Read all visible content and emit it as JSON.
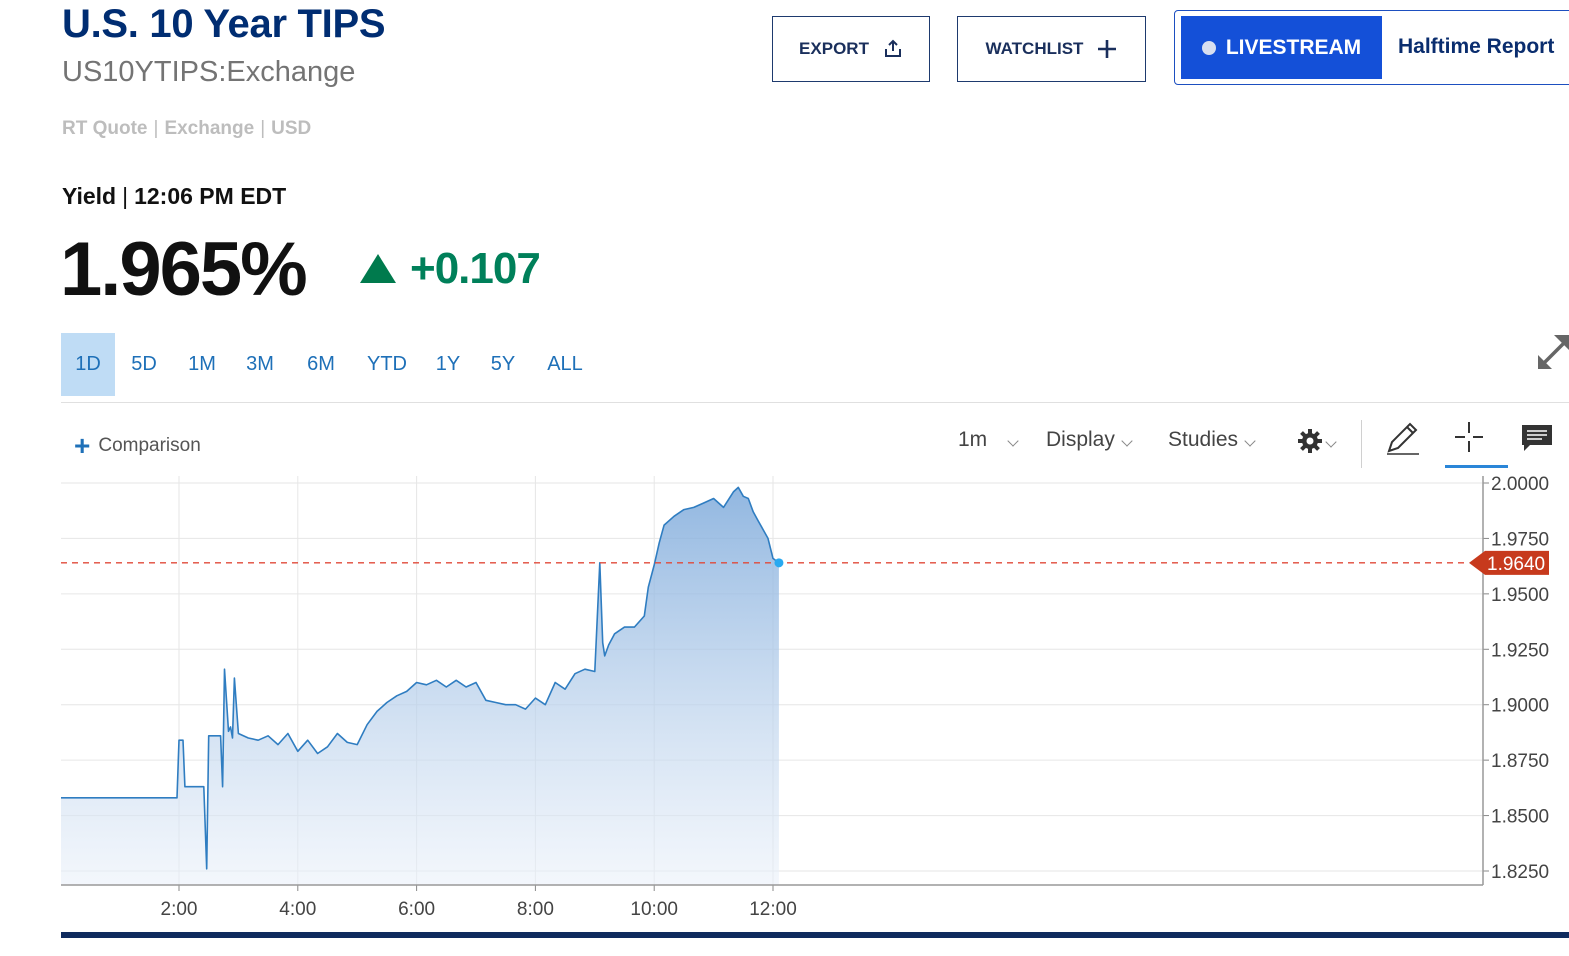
{
  "header": {
    "title": "U.S. 10 Year TIPS",
    "symbol": "US10YTIPS:Exchange",
    "quote_type": "RT Quote",
    "exchange": "Exchange",
    "currency": "USD",
    "yield_label": "Yield",
    "time": "12:06 PM EDT",
    "price": "1.965%",
    "change": "+0.107",
    "change_direction": "up",
    "change_color": "#00805a"
  },
  "actions": {
    "export_label": "EXPORT",
    "watchlist_label": "WATCHLIST",
    "livestream_label": "LIVESTREAM",
    "livestream_show": "Halftime Report"
  },
  "range_tabs": [
    {
      "label": "1D",
      "active": true
    },
    {
      "label": "5D",
      "active": false
    },
    {
      "label": "1M",
      "active": false
    },
    {
      "label": "3M",
      "active": false
    },
    {
      "label": "6M",
      "active": false
    },
    {
      "label": "YTD",
      "active": false
    },
    {
      "label": "1Y",
      "active": false
    },
    {
      "label": "5Y",
      "active": false
    },
    {
      "label": "ALL",
      "active": false
    }
  ],
  "toolbar": {
    "comparison_label": "Comparison",
    "interval_label": "1m",
    "display_label": "Display",
    "studies_label": "Studies",
    "icons": [
      "settings-gear-icon",
      "draw-pencil-icon",
      "crosshair-icon",
      "comment-icon"
    ]
  },
  "chart_data": {
    "type": "area",
    "x_ticks": [
      "2:00",
      "4:00",
      "6:00",
      "8:00",
      "10:00",
      "12:00"
    ],
    "y_ticks": [
      "2.0000",
      "1.9750",
      "1.9500",
      "1.9250",
      "1.9000",
      "1.8750",
      "1.8500",
      "1.8250"
    ],
    "ylim": [
      1.82,
      2.0
    ],
    "current_value": "1.9640",
    "current_line_color": "#e04a3a",
    "series_color": "#2f7dc1",
    "grid": true,
    "series": [
      {
        "x": [
          "0:00",
          "1:58",
          "2:00",
          "2:04",
          "2:06",
          "2:25",
          "2:28",
          "2:30",
          "2:42",
          "2:44",
          "2:46",
          "2:50",
          "2:52",
          "2:54",
          "2:56",
          "3:00",
          "3:10",
          "3:20",
          "3:30",
          "3:40",
          "3:50",
          "4:00",
          "4:10",
          "4:20",
          "4:30",
          "4:40",
          "4:50",
          "5:00",
          "5:10",
          "5:20",
          "5:30",
          "5:40",
          "5:50",
          "6:00",
          "6:10",
          "6:20",
          "6:30",
          "6:40",
          "6:50",
          "7:00",
          "7:10",
          "7:20",
          "7:30",
          "7:40",
          "7:50",
          "8:00",
          "8:10",
          "8:20",
          "8:30",
          "8:40",
          "8:50",
          "9:00",
          "9:05",
          "9:08",
          "9:10",
          "9:14",
          "9:20",
          "9:30",
          "9:40",
          "9:50",
          "9:54",
          "10:00",
          "10:05",
          "10:10",
          "10:20",
          "10:30",
          "10:40",
          "10:50",
          "11:00",
          "11:10",
          "11:20",
          "11:25",
          "11:30",
          "11:35",
          "11:40",
          "11:45",
          "11:50",
          "11:55",
          "12:00",
          "12:06"
        ],
        "values": [
          1.858,
          1.858,
          1.884,
          1.884,
          1.863,
          1.863,
          1.826,
          1.886,
          1.886,
          1.863,
          1.916,
          1.888,
          1.89,
          1.885,
          1.912,
          1.887,
          1.885,
          1.884,
          1.886,
          1.882,
          1.887,
          1.879,
          1.884,
          1.878,
          1.881,
          1.887,
          1.883,
          1.882,
          1.891,
          1.897,
          1.901,
          1.904,
          1.906,
          1.91,
          1.909,
          1.911,
          1.908,
          1.911,
          1.908,
          1.91,
          1.902,
          1.901,
          1.9,
          1.9,
          1.898,
          1.903,
          1.9,
          1.91,
          1.907,
          1.914,
          1.916,
          1.915,
          1.964,
          1.928,
          1.922,
          1.927,
          1.932,
          1.935,
          1.935,
          1.94,
          1.953,
          1.963,
          1.973,
          1.981,
          1.985,
          1.988,
          1.989,
          1.991,
          1.993,
          1.989,
          1.996,
          1.998,
          1.994,
          1.993,
          1.987,
          1.983,
          1.979,
          1.975,
          1.966,
          1.964
        ]
      }
    ]
  }
}
